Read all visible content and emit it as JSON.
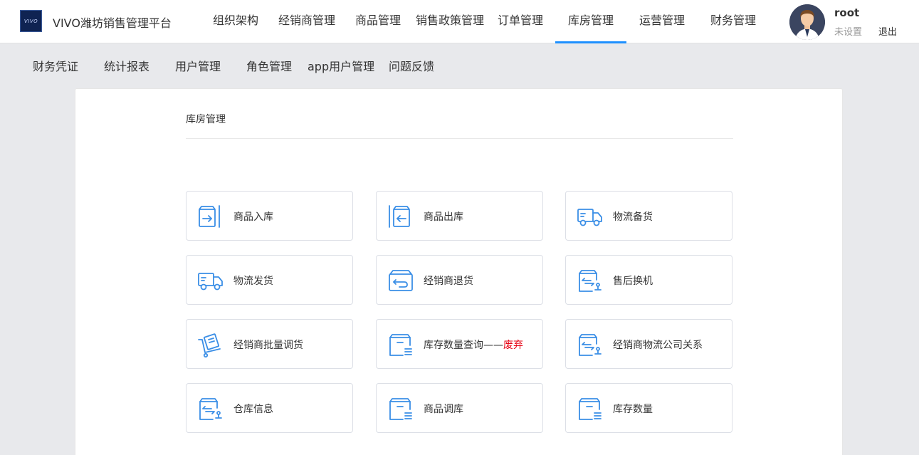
{
  "header": {
    "logo_text": "VIVO",
    "app_title": "VIVO潍坊销售管理平台",
    "nav": [
      {
        "label": "组织架构"
      },
      {
        "label": "经销商管理"
      },
      {
        "label": "商品管理"
      },
      {
        "label": "销售政策管理"
      },
      {
        "label": "订单管理"
      },
      {
        "label": "库房管理",
        "active": true
      },
      {
        "label": "运营管理"
      },
      {
        "label": "财务管理"
      }
    ],
    "user": {
      "name": "root",
      "setting": "未设置",
      "logout": "退出"
    }
  },
  "subnav": [
    {
      "label": "财务凭证"
    },
    {
      "label": "统计报表"
    },
    {
      "label": "用户管理"
    },
    {
      "label": "角色管理"
    },
    {
      "label": "app用户管理"
    },
    {
      "label": "问题反馈"
    }
  ],
  "main": {
    "section_title": "库房管理",
    "tiles": [
      {
        "label": "商品入库",
        "icon": "box-in-icon"
      },
      {
        "label": "商品出库",
        "icon": "box-out-icon"
      },
      {
        "label": "物流备货",
        "icon": "truck-icon"
      },
      {
        "label": "物流发货",
        "icon": "truck-icon"
      },
      {
        "label": "经销商退货",
        "icon": "box-return-icon"
      },
      {
        "label": "售后换机",
        "icon": "exchange-icon"
      },
      {
        "label": "经销商批量调货",
        "icon": "cart-icon"
      },
      {
        "label": "库存数量查询——",
        "suffix": "废弃",
        "icon": "inventory-box-icon"
      },
      {
        "label": "经销商物流公司关系",
        "icon": "exchange-icon"
      },
      {
        "label": "仓库信息",
        "icon": "exchange-icon"
      },
      {
        "label": "商品调库",
        "icon": "inventory-box-icon"
      },
      {
        "label": "库存数量",
        "icon": "inventory-box-icon"
      }
    ]
  },
  "colors": {
    "accent": "#1e90ff",
    "icon": "#3a8ee6",
    "deprecated": "#e60012"
  }
}
